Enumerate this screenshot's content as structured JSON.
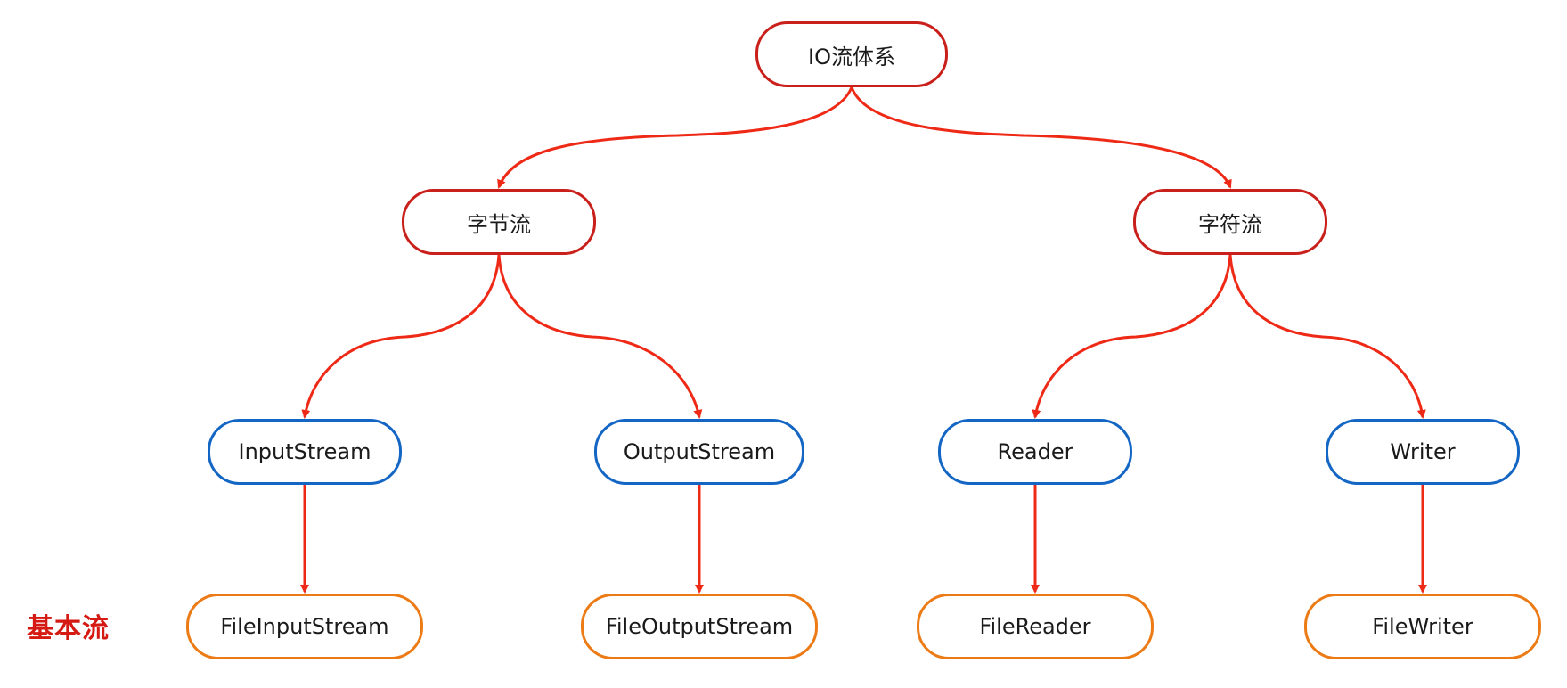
{
  "diagram": {
    "root": {
      "label": "IO流体系"
    },
    "byte_stream": {
      "label": "字节流"
    },
    "char_stream": {
      "label": "字符流"
    },
    "input_stream": {
      "label": "InputStream"
    },
    "output_stream": {
      "label": "OutputStream"
    },
    "reader": {
      "label": "Reader"
    },
    "writer": {
      "label": "Writer"
    },
    "file_input_stream": {
      "label": "FileInputStream"
    },
    "file_output_stream": {
      "label": "FileOutputStream"
    },
    "file_reader": {
      "label": "FileReader"
    },
    "file_writer": {
      "label": "FileWriter"
    },
    "side_label": "基本流"
  },
  "colors": {
    "edge": "#ee2a17",
    "category_border": "#c9201b",
    "abstract_border": "#1466c4",
    "concrete_border": "#ec7b16",
    "side_label": "#d41a12"
  }
}
